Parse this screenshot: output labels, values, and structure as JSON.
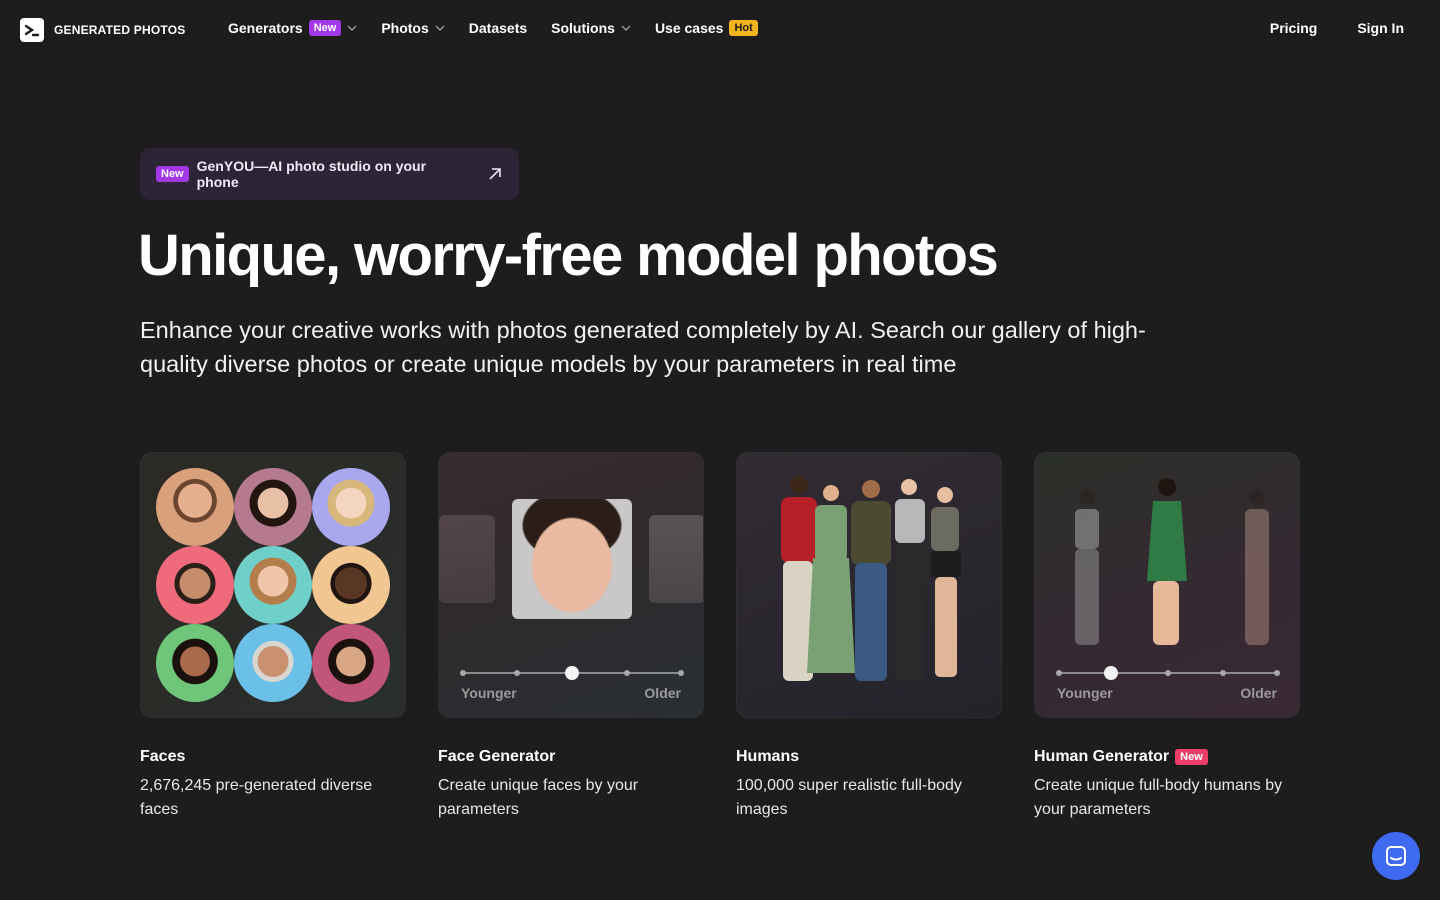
{
  "brand": {
    "name": "GENERATED PHOTOS"
  },
  "nav": {
    "items": [
      {
        "label": "Generators",
        "badge": "New",
        "dropdown": true
      },
      {
        "label": "Photos",
        "dropdown": true
      },
      {
        "label": "Datasets"
      },
      {
        "label": "Solutions",
        "dropdown": true
      },
      {
        "label": "Use cases",
        "badge": "Hot"
      }
    ],
    "pricing": "Pricing",
    "sign_in": "Sign In"
  },
  "promo": {
    "badge": "New",
    "text": "GenYOU—AI photo studio on your phone"
  },
  "hero": {
    "title": "Unique, worry-free model photos",
    "subtitle": "Enhance your creative works with photos generated completely by AI. Search our gallery of high-quality diverse photos or create unique models by your parameters in real time"
  },
  "cards": [
    {
      "title": "Faces",
      "desc": "2,676,245 pre-generated diverse faces"
    },
    {
      "title": "Face Generator",
      "desc": "Create unique faces by your parameters",
      "slider": {
        "left": "Younger",
        "right": "Older",
        "value": 0.5
      }
    },
    {
      "title": "Humans",
      "desc": "100,000 super realistic full-body images"
    },
    {
      "title": "Human Generator",
      "badge": "New",
      "desc": "Create unique full-body humans by your parameters",
      "slider": {
        "left": "Younger",
        "right": "Older",
        "value": 0.25
      }
    }
  ],
  "colors": {
    "accent_purple": "#a238e8",
    "hot_yellow": "#f2b51c",
    "new_red": "#ec3f68",
    "chat_blue": "#3e6bf0"
  },
  "icons": {
    "chat": "chat-icon",
    "arrow": "external-arrow-icon"
  }
}
